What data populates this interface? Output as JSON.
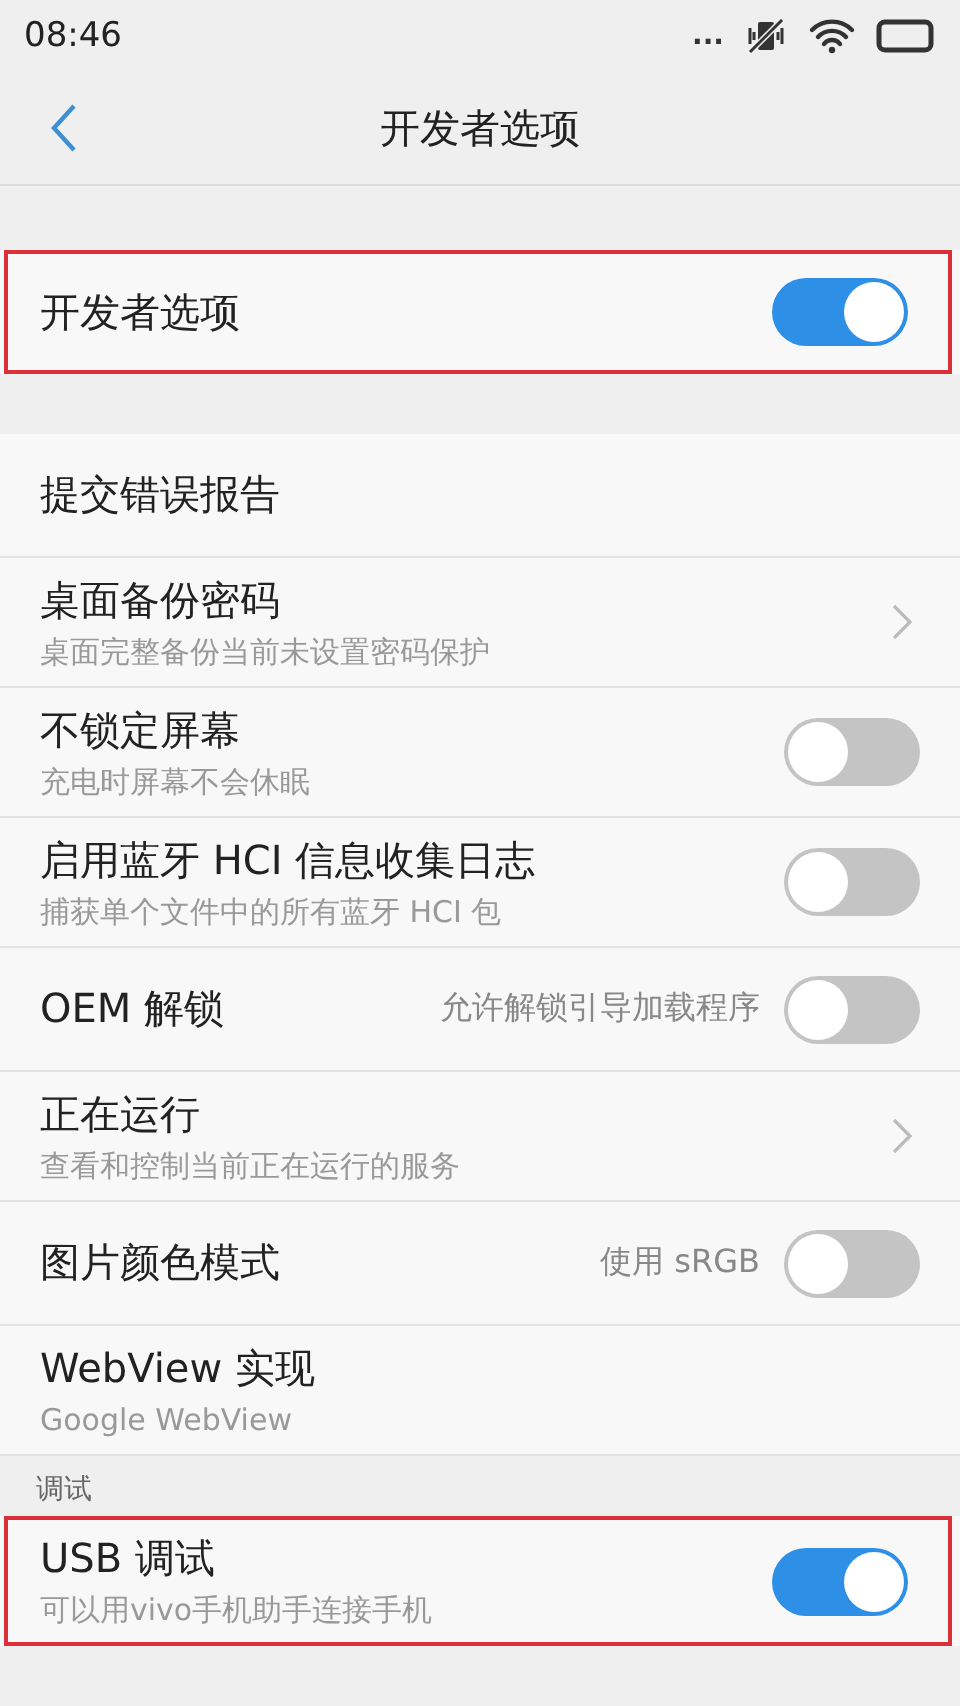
{
  "status_bar": {
    "time": "08:46",
    "more": "..."
  },
  "header": {
    "title": "开发者选项"
  },
  "groups": [
    {
      "items": [
        {
          "kind": "switch",
          "title": "开发者选项",
          "on": true,
          "highlighted": true
        }
      ]
    },
    {
      "items": [
        {
          "kind": "plain",
          "title": "提交错误报告",
          "highlighted": false
        },
        {
          "kind": "chevron",
          "title": "桌面备份密码",
          "subtitle": "桌面完整备份当前未设置密码保护",
          "highlighted": false
        },
        {
          "kind": "switch",
          "title": "不锁定屏幕",
          "subtitle": "充电时屏幕不会休眠",
          "on": false,
          "highlighted": false
        },
        {
          "kind": "switch",
          "title": "启用蓝牙 HCI 信息收集日志",
          "subtitle": "捕获单个文件中的所有蓝牙 HCI 包",
          "on": false,
          "highlighted": false
        },
        {
          "kind": "switch",
          "title": "OEM 解锁",
          "value": "允许解锁引导加载程序",
          "on": false,
          "highlighted": false
        },
        {
          "kind": "chevron",
          "title": "正在运行",
          "subtitle": "查看和控制当前正在运行的服务",
          "highlighted": false
        },
        {
          "kind": "switch",
          "title": "图片颜色模式",
          "value": "使用 sRGB",
          "on": false,
          "highlighted": false
        },
        {
          "kind": "plain",
          "title": "WebView 实现",
          "subtitle": "Google WebView",
          "highlighted": false
        }
      ]
    },
    {
      "header": "调试",
      "items": [
        {
          "kind": "switch",
          "title": "USB 调试",
          "subtitle": "可以用vivo手机助手连接手机",
          "on": true,
          "highlighted": true
        }
      ]
    }
  ]
}
